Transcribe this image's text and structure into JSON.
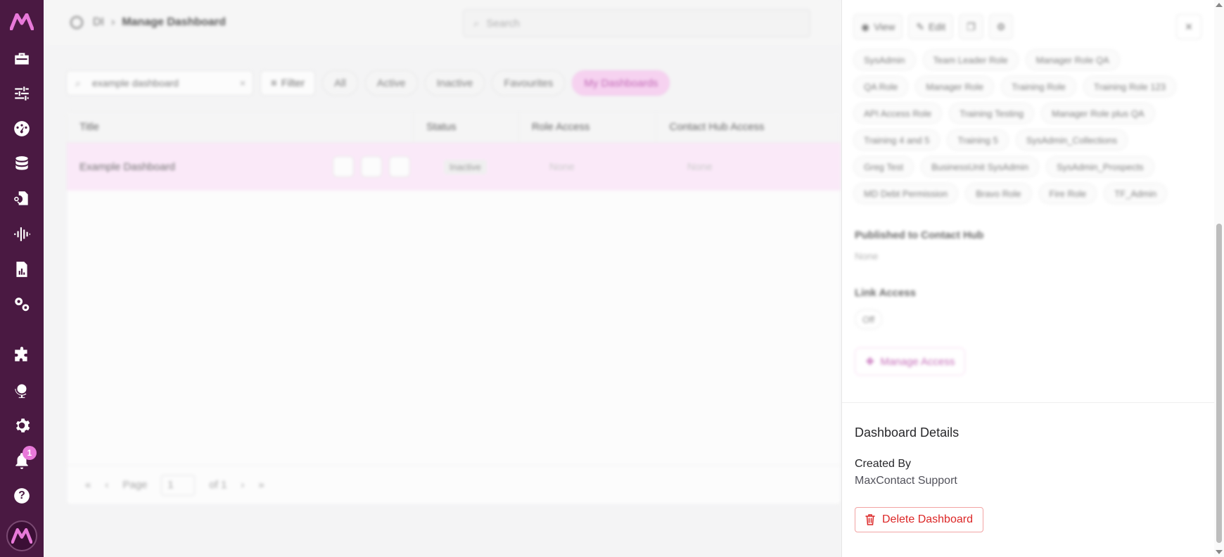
{
  "app": {
    "brand_color": "#4a1942",
    "accent": "#e879d9"
  },
  "sidebar": {
    "logo": "M",
    "items": [
      {
        "icon": "toolbox-icon"
      },
      {
        "icon": "sliders-icon"
      },
      {
        "icon": "gauge-icon"
      },
      {
        "icon": "database-icon"
      },
      {
        "icon": "file-search-icon"
      },
      {
        "icon": "waveform-icon"
      },
      {
        "icon": "report-icon"
      },
      {
        "icon": "cogs-icon"
      },
      {
        "icon": "puzzle-icon"
      },
      {
        "icon": "globe-icon"
      },
      {
        "icon": "gear-icon"
      },
      {
        "icon": "bell-icon"
      },
      {
        "icon": "help-icon"
      }
    ],
    "notification_count": "1",
    "help_glyph": "?",
    "avatar": "M"
  },
  "topbar": {
    "breadcrumb": [
      "DI",
      "›",
      "Manage Dashboard"
    ],
    "search_placeholder": "Search"
  },
  "filters": {
    "search_value": "example dashboard",
    "clear_glyph": "×",
    "filter_label": "Filter",
    "chips": [
      "All",
      "Active",
      "Inactive",
      "Favourites",
      "My Dashboards"
    ],
    "active_chip": "My Dashboards"
  },
  "table": {
    "columns": [
      "Title",
      "Status",
      "Role Access",
      "Contact Hub Access"
    ],
    "rows": [
      {
        "title": "Example Dashboard",
        "status": "Inactive",
        "role_access": "None",
        "contact_hub_access": "None"
      }
    ],
    "pager": {
      "first": "«",
      "prev": "‹",
      "page_label": "Page",
      "page_value": "1",
      "of_label": "of 1",
      "next": "›",
      "last": "»"
    }
  },
  "panel": {
    "toolbar": {
      "view_label": "View",
      "edit_label": "Edit",
      "close_glyph": "×"
    },
    "roles": [
      "SysAdmin",
      "Team Leader Role",
      "Manager Role QA",
      "QA Role",
      "Manager Role",
      "Training Role",
      "Training Role 123",
      "API Access Role",
      "Training Testing",
      "Manager Role plus QA",
      "Training 4 and 5",
      "Training 5",
      "SysAdmin_Collections",
      "Greg Test",
      "BusinessUnit SysAdmin",
      "SysAdmin_Prospects",
      "MD Debt Permission",
      "Bravo Role",
      "Fire Role",
      "TF_Admin"
    ],
    "published": {
      "title": "Published to Contact Hub",
      "value": "None"
    },
    "link_access": {
      "title": "Link Access",
      "value": "Off"
    },
    "manage_access_label": "Manage Access",
    "details": {
      "title": "Dashboard Details",
      "created_by_label": "Created By",
      "created_by_value": "MaxContact Support",
      "delete_label": "Delete Dashboard"
    }
  }
}
